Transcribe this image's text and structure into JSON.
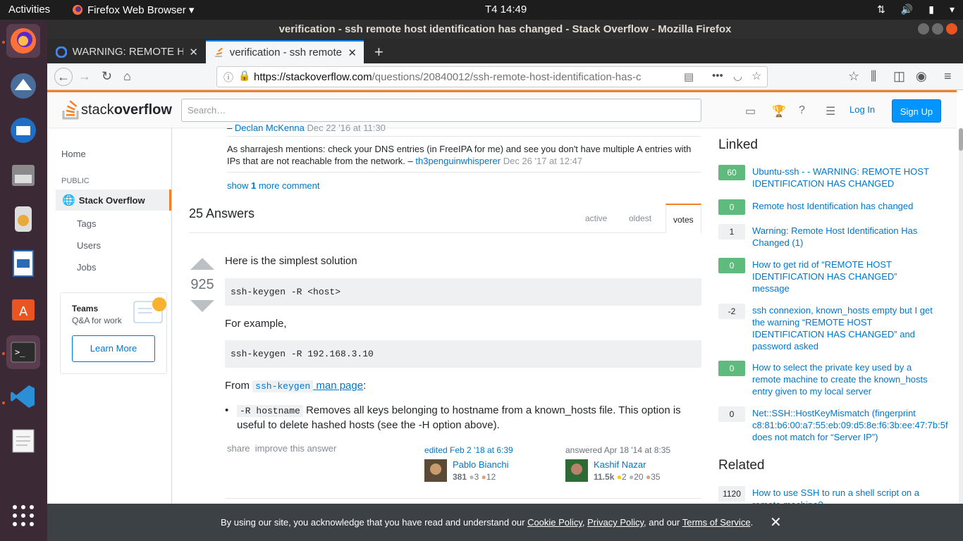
{
  "system": {
    "activities": "Activities",
    "app_menu": "Firefox Web Browser ▾",
    "clock": "T4 14:49"
  },
  "window": {
    "title": "verification - ssh remote host identification has changed - Stack Overflow - Mozilla Firefox"
  },
  "tabs": [
    {
      "title": "WARNING: REMOTE HOS",
      "active": false
    },
    {
      "title": "verification - ssh remote",
      "active": true
    }
  ],
  "navbar": {
    "url_domain": "https://stackoverflow.com",
    "url_path": "/questions/20840012/ssh-remote-host-identification-has-c",
    "more": "•••"
  },
  "so_header": {
    "logo_text": "stack",
    "logo_text_bold": "overflow",
    "search_placeholder": "Search…",
    "login": "Log In",
    "signup": "Sign Up"
  },
  "leftnav": {
    "home": "Home",
    "public": "PUBLIC",
    "stack_overflow": "Stack Overflow",
    "tags": "Tags",
    "users": "Users",
    "jobs": "Jobs",
    "teams_title": "Teams",
    "teams_sub": "Q&A for work",
    "learn_more": "Learn More"
  },
  "comments": {
    "c1_author": "Declan McKenna",
    "c1_date": "Dec 22 '16 at 11:30",
    "c2_text": "As sharrajesh mentions: check your DNS entries (in FreeIPA for me) and see you don't have multiple A entries with IPs that are not reachable from the network. – ",
    "c2_author": "th3penguinwhisperer",
    "c2_date": "Dec 26 '17 at 12:47",
    "show_more_prefix": "show ",
    "show_more_count": "1",
    "show_more_suffix": " more comment"
  },
  "answers": {
    "header": "25 Answers",
    "sort_active": "active",
    "sort_oldest": "oldest",
    "sort_votes": "votes",
    "votes": "925",
    "p1": "Here is the simplest solution",
    "code1": "ssh-keygen -R <host>",
    "p2": "For example,",
    "code2": "ssh-keygen -R 192.168.3.10",
    "from": "From ",
    "from_code": "ssh-keygen",
    "from_link": " man page",
    "from_end": ":",
    "bullet_code": "-R hostname",
    "bullet_text": " Removes all keys belonging to hostname from a known_hosts file. This option is useful to delete hashed hosts (see the -H option above).",
    "share": "share",
    "improve": "improve this answer",
    "edited": "edited Feb 2 '18 at 6:39",
    "editor_name": "Pablo Bianchi",
    "editor_rep": "381",
    "editor_silver": "3",
    "editor_bronze": "12",
    "answered": "answered Apr 18 '14 at 8:35",
    "author_name": "Kashif Nazar",
    "author_rep": "11.5k",
    "author_gold": "2",
    "author_silver": "20",
    "author_bronze": "35"
  },
  "sidebar": {
    "linked_title": "Linked",
    "linked": [
      {
        "score": "60",
        "accepted": true,
        "text": "Ubuntu-ssh - - WARNING: REMOTE HOST IDENTIFICATION HAS CHANGED"
      },
      {
        "score": "0",
        "accepted": true,
        "text": "Remote host Identification has changed"
      },
      {
        "score": "1",
        "accepted": false,
        "text": "Warning: Remote Host Identification Has Changed (1)"
      },
      {
        "score": "0",
        "accepted": true,
        "text": "How to get rid of “REMOTE HOST IDENTIFICATION HAS CHANGED” message"
      },
      {
        "score": "-2",
        "accepted": false,
        "text": "ssh connexion, known_hosts empty but I get the warning “REMOTE HOST IDENTIFICATION HAS CHANGED” and password asked"
      },
      {
        "score": "0",
        "accepted": true,
        "text": "How to select the private key used by a remote machine to create the known_hosts entry given to my local server"
      },
      {
        "score": "0",
        "accepted": false,
        "text": "Net::SSH::HostKeyMismatch (fingerprint c8:81:b6:00:a7:55:eb:09:d5:8e:f6:3b:ee:47:7b:5f does not match for “Server IP”)"
      }
    ],
    "related_title": "Related",
    "related": [
      {
        "score": "1120",
        "accepted": false,
        "text": "How to use SSH to run a shell script on a remote machine?"
      }
    ]
  },
  "cookie": {
    "text1": "By using our site, you acknowledge that you have read and understand our ",
    "cookie_policy": "Cookie Policy",
    "sep1": ", ",
    "privacy_policy": "Privacy Policy",
    "sep2": ", and our ",
    "terms": "Terms of Service",
    "end": ".",
    "close": "✕"
  },
  "colors": {
    "accent": "#f48024",
    "link": "#0077cc",
    "accepted": "#5eba7d",
    "ubuntu_orange": "#e95420"
  }
}
